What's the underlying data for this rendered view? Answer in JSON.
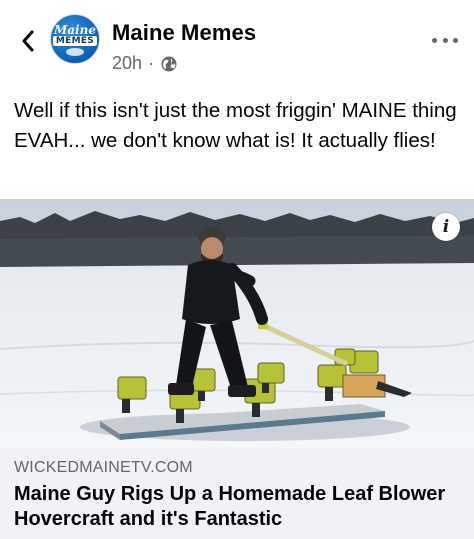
{
  "post": {
    "page_name": "Maine Memes",
    "time": "20h",
    "separator": "·",
    "privacy_icon": "globe-icon",
    "text": "Well if this isn't just the most friggin' MAINE thing EVAH... we don't know what is! It actually flies!"
  },
  "avatar": {
    "line1": "Maine",
    "line2": "MEMES"
  },
  "media": {
    "info_label": "i"
  },
  "link": {
    "domain": "WICKEDMAINETV.COM",
    "title": "Maine Guy Rigs Up a Homemade Leaf Blower Hovercraft and it's Fantastic"
  },
  "colors": {
    "text_primary": "#050505",
    "text_secondary": "#65676b",
    "link_background": "#f0f2f5",
    "avatar_blue": "#0e5fb4"
  }
}
